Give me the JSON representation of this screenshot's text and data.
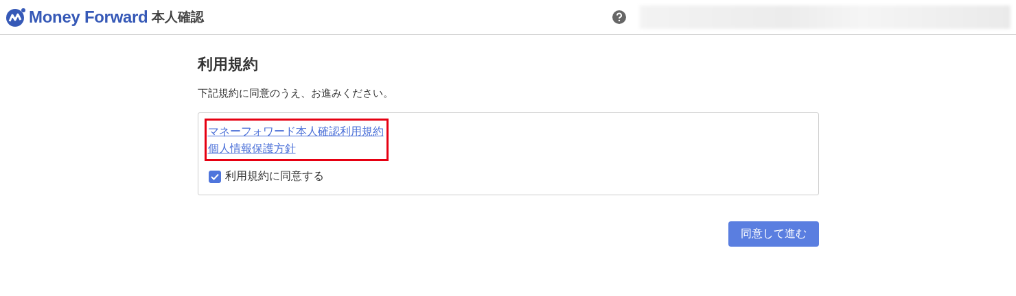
{
  "header": {
    "brand": "Money Forward",
    "product": "本人確認"
  },
  "title": "利用規約",
  "description": "下記規約に同意のうえ、お進みください。",
  "terms_box": {
    "links_highlighted": true,
    "links": [
      "マネーフォワード本人確認利用規約",
      "個人情報保護方針"
    ],
    "agree": {
      "label": "利用規約に同意する",
      "checked": true
    }
  },
  "submit_button": "同意して進む"
}
